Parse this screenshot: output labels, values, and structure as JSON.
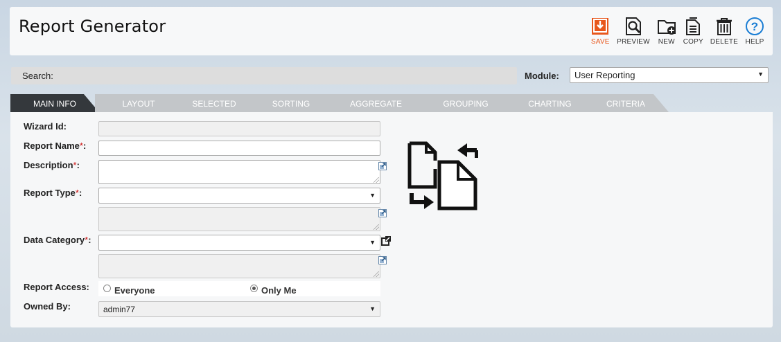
{
  "header": {
    "title": "Report Generator"
  },
  "toolbar": [
    {
      "key": "save",
      "label": "SAVE",
      "icon": "save-icon",
      "color": "#e8561b"
    },
    {
      "key": "preview",
      "label": "PREVIEW",
      "icon": "preview-icon"
    },
    {
      "key": "new",
      "label": "NEW",
      "icon": "new-folder-icon"
    },
    {
      "key": "copy",
      "label": "COPY",
      "icon": "copy-icon"
    },
    {
      "key": "delete",
      "label": "DELETE",
      "icon": "trash-icon"
    },
    {
      "key": "help",
      "label": "HELP",
      "icon": "help-icon",
      "color": "#1a7dd4"
    }
  ],
  "search": {
    "label": "Search:"
  },
  "module": {
    "label": "Module:",
    "value": "User Reporting"
  },
  "tabs": [
    "MAIN INFO",
    "LAYOUT",
    "SELECTED",
    "SORTING",
    "AGGREGATE",
    "GROUPING",
    "CHARTING",
    "CRITERIA"
  ],
  "form": {
    "wizard_id": {
      "label": "Wizard Id:",
      "value": ""
    },
    "report_name": {
      "label": "Report Name",
      "required": "*",
      "suffix": ":",
      "value": ""
    },
    "description": {
      "label": "Description",
      "required": "*",
      "suffix": ":",
      "value": ""
    },
    "report_type": {
      "label": "Report Type",
      "required": "*",
      "suffix": ":",
      "value": "",
      "description": ""
    },
    "data_category": {
      "label": "Data Category",
      "required": "*",
      "suffix": ":",
      "value": "",
      "description": ""
    },
    "report_access": {
      "label": "Report Access:",
      "options": [
        "Everyone",
        "Only Me"
      ],
      "selected": "Only Me"
    },
    "owned_by": {
      "label": "Owned By:",
      "value": "admin77"
    }
  },
  "colors": {
    "accent": "#e8561b",
    "tab_active": "#34383c",
    "tab_inactive": "#c3c6c9",
    "help": "#1a7dd4",
    "required": "#cc1111"
  }
}
